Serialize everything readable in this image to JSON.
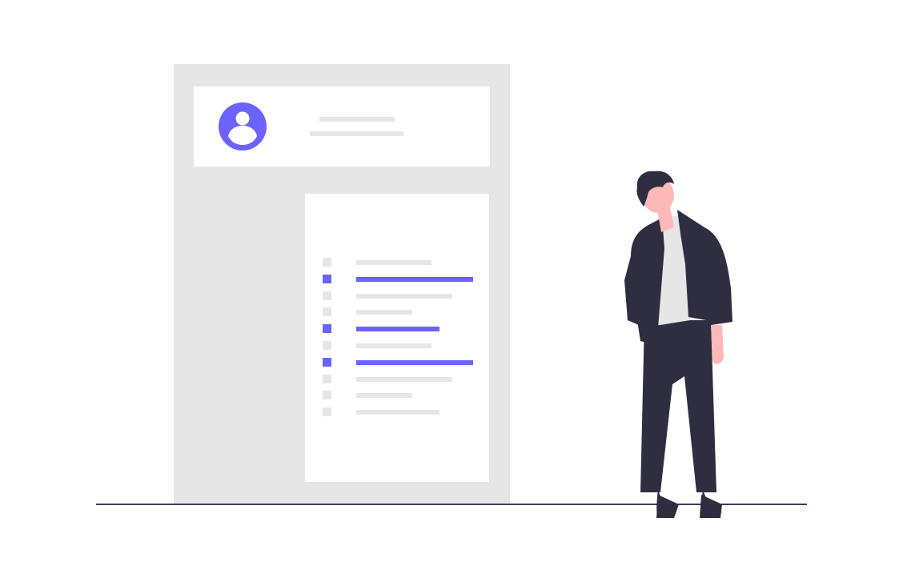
{
  "colors": {
    "accent": "#6c63ff",
    "panel_gray": "#e6e6e6",
    "card_white": "#ffffff",
    "ground_line": "#3f3d56",
    "suit_dark": "#2f2e41",
    "skin": "#ffb8b8",
    "shirt": "#e6e6e6"
  },
  "illustration": {
    "avatar_icon": "user-circle-icon",
    "person_icon": "standing-man-icon"
  },
  "list": {
    "rows": [
      {
        "active": false,
        "fill": 0.47
      },
      {
        "active": true,
        "fill": 0.73
      },
      {
        "active": false,
        "fill": 0.6
      },
      {
        "active": false,
        "fill": 0.35
      },
      {
        "active": true,
        "fill": 0.52
      },
      {
        "active": false,
        "fill": 0.47
      },
      {
        "active": true,
        "fill": 0.73
      },
      {
        "active": false,
        "fill": 0.6
      },
      {
        "active": false,
        "fill": 0.35
      },
      {
        "active": false,
        "fill": 0.52
      }
    ]
  }
}
